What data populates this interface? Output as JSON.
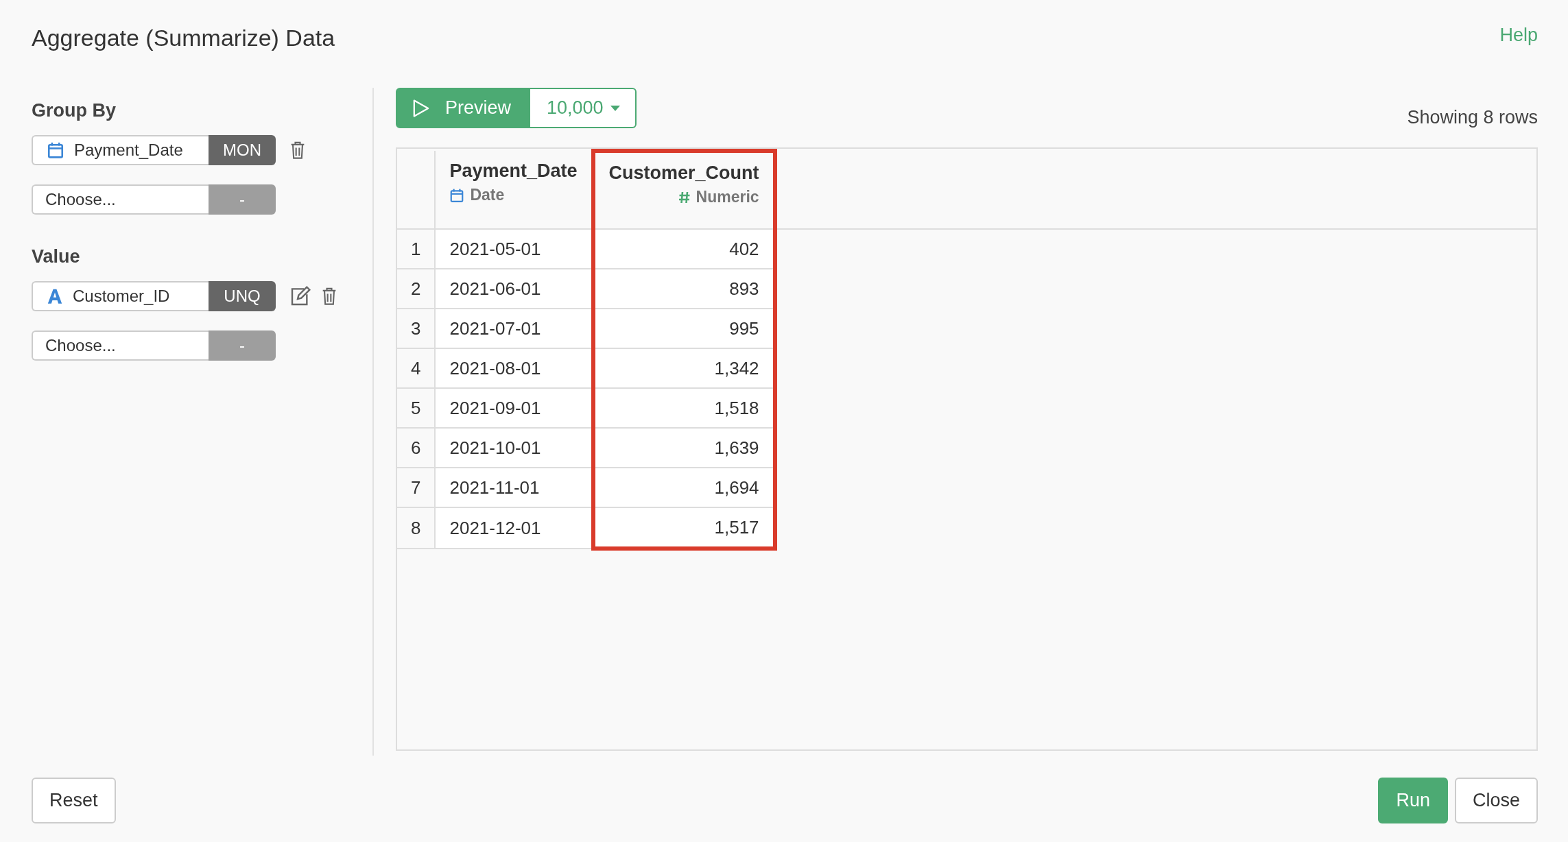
{
  "title": "Aggregate (Summarize) Data",
  "help_link": "Help",
  "group_by": {
    "label": "Group By",
    "fields": [
      {
        "value": "Payment_Date",
        "kind": "date",
        "function": "MON",
        "editable": false
      },
      {
        "placeholder": "Choose...",
        "kind": "none",
        "function": "-",
        "editable": false
      }
    ]
  },
  "value": {
    "label": "Value",
    "fields": [
      {
        "value": "Customer_ID",
        "kind": "text",
        "function": "UNQ",
        "editable": true
      },
      {
        "placeholder": "Choose...",
        "kind": "none",
        "function": "-",
        "editable": false
      }
    ]
  },
  "preview": {
    "label": "Preview",
    "limit": "10,000"
  },
  "row_count": "Showing 8 rows",
  "table": {
    "columns": [
      {
        "name": "Payment_Date",
        "type": "Date",
        "kind": "date",
        "highlighted": false
      },
      {
        "name": "Customer_Count",
        "type": "Numeric",
        "kind": "numeric",
        "highlighted": true
      }
    ],
    "rows": [
      {
        "index": "1",
        "cells": [
          "2021-05-01",
          "402"
        ]
      },
      {
        "index": "2",
        "cells": [
          "2021-06-01",
          "893"
        ]
      },
      {
        "index": "3",
        "cells": [
          "2021-07-01",
          "995"
        ]
      },
      {
        "index": "4",
        "cells": [
          "2021-08-01",
          "1,342"
        ]
      },
      {
        "index": "5",
        "cells": [
          "2021-09-01",
          "1,518"
        ]
      },
      {
        "index": "6",
        "cells": [
          "2021-10-01",
          "1,639"
        ]
      },
      {
        "index": "7",
        "cells": [
          "2021-11-01",
          "1,694"
        ]
      },
      {
        "index": "8",
        "cells": [
          "2021-12-01",
          "1,517"
        ]
      }
    ]
  },
  "buttons": {
    "reset": "Reset",
    "run": "Run",
    "close": "Close"
  }
}
